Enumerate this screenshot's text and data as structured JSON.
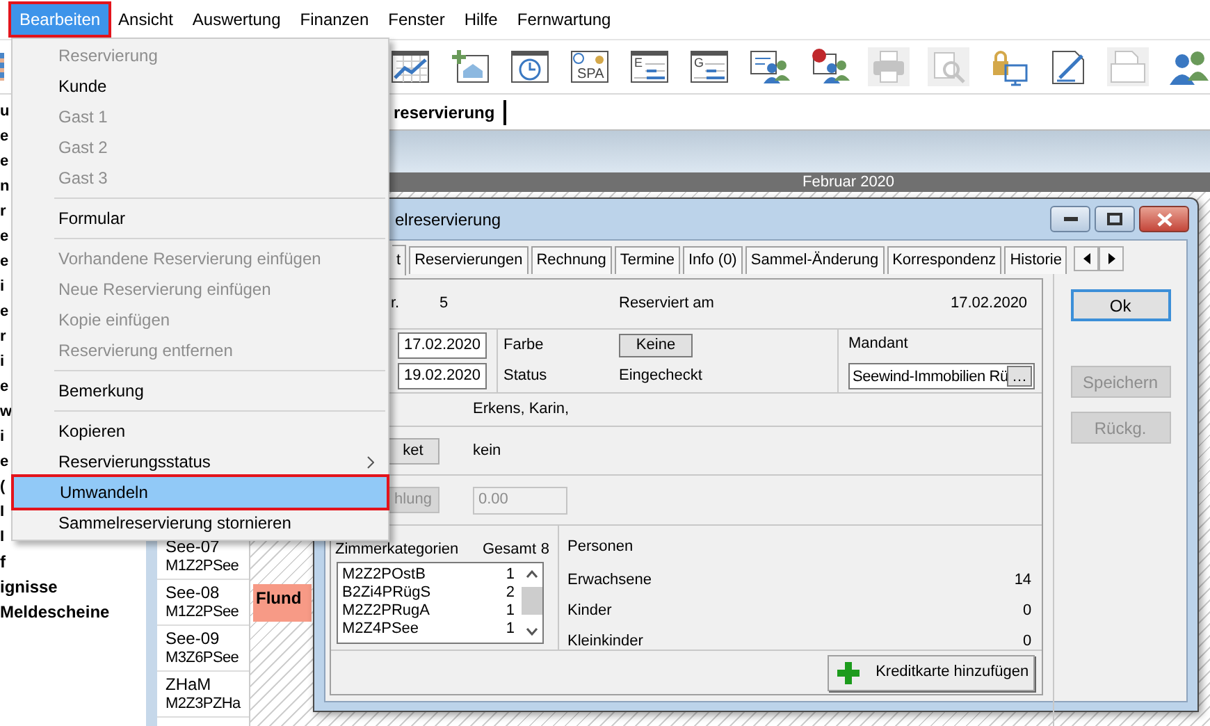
{
  "menubar": [
    {
      "label": "Bearbeiten",
      "selected": true
    },
    {
      "label": "Ansicht",
      "selected": false
    },
    {
      "label": "Auswertung",
      "selected": false
    },
    {
      "label": "Finanzen",
      "selected": false
    },
    {
      "label": "Fenster",
      "selected": false
    },
    {
      "label": "Hilfe",
      "selected": false
    },
    {
      "label": "Fernwartung",
      "selected": false
    }
  ],
  "toolbar": [
    {
      "kind": "chart",
      "disabled": false
    },
    {
      "kind": "add-house",
      "disabled": false
    },
    {
      "kind": "clock",
      "disabled": false
    },
    {
      "kind": "spa",
      "label": "SPA",
      "disabled": false
    },
    {
      "kind": "list",
      "label": "E",
      "disabled": false
    },
    {
      "kind": "list",
      "label": "G",
      "disabled": false
    },
    {
      "kind": "guests",
      "disabled": false
    },
    {
      "kind": "guests-question",
      "disabled": false
    },
    {
      "kind": "printer",
      "disabled": true
    },
    {
      "kind": "preview",
      "disabled": true
    },
    {
      "kind": "lock-screen",
      "disabled": false
    },
    {
      "kind": "edit",
      "disabled": false
    },
    {
      "kind": "letter",
      "disabled": true
    },
    {
      "kind": "users",
      "disabled": false
    }
  ],
  "document_tab": {
    "label": "reservierung"
  },
  "sidebar": {
    "fragments": [
      "u",
      "e",
      "e",
      "n",
      "r",
      "e",
      "e",
      "i",
      "e",
      "r",
      "i",
      "e",
      "w",
      "i",
      "e",
      "(",
      "I",
      "I"
    ],
    "items": [
      "f",
      "ignisse",
      "Meldescheine"
    ]
  },
  "calendar": {
    "month": "Februar 2020",
    "rooms": [
      {
        "name": "See-07",
        "category": "M1Z2PSee"
      },
      {
        "name": "See-08",
        "category": "M1Z2PSee",
        "booking": {
          "label": "Flund",
          "color": "#f79a86"
        }
      },
      {
        "name": "See-09",
        "category": "M3Z6PSee"
      },
      {
        "name": "ZHaM",
        "category": "M2Z3PZHa"
      }
    ]
  },
  "dialog": {
    "title": "elreservierung",
    "tabs": [
      {
        "label": "t",
        "selected": true
      },
      {
        "label": "Reservierungen",
        "selected": false
      },
      {
        "label": "Rechnung",
        "selected": false
      },
      {
        "label": "Termine",
        "selected": false
      },
      {
        "label": "Info (0)",
        "selected": false
      },
      {
        "label": "Sammel-Änderung",
        "selected": false
      },
      {
        "label": "Korrespondenz",
        "selected": false
      },
      {
        "label": "Historie",
        "selected": false
      }
    ],
    "number_label": "r.",
    "number": "5",
    "reserved_label": "Reserviert am",
    "reserved_date": "17.02.2020",
    "arrival": "17.02.2020",
    "departure": "19.02.2020",
    "color_label": "Farbe",
    "color_button": "Keine",
    "status_label": "Status",
    "status": "Eingecheckt",
    "client_label": "Mandant",
    "client": "Seewind-Immobilien Rü",
    "client_button": "…",
    "guest": "Erkens, Karin,",
    "ticket_button": "ket",
    "ticket": "kein",
    "payment_button": {
      "label": "hlung",
      "disabled": true
    },
    "payment": {
      "value": "0.00",
      "disabled": true
    },
    "room_categories": {
      "label": "Zimmerkategorien",
      "total_label": "Gesamt",
      "total": "8",
      "rows": [
        {
          "name": "M2Z2POstB",
          "count": "1"
        },
        {
          "name": "B2Zi4PRügS",
          "count": "2"
        },
        {
          "name": "M2Z2PRugA",
          "count": "1"
        },
        {
          "name": "M2Z4PSee",
          "count": "1"
        }
      ]
    },
    "persons": {
      "label": "Personen",
      "rows": [
        {
          "label": "Erwachsene",
          "value": "14"
        },
        {
          "label": "Kinder",
          "value": "0"
        },
        {
          "label": "Kleinkinder",
          "value": "0"
        }
      ]
    },
    "credit_card_button": "Kreditkarte hinzufügen",
    "buttons": [
      {
        "label": "Ok",
        "default": true,
        "disabled": false
      },
      {
        "label": "Speichern",
        "default": false,
        "disabled": true
      },
      {
        "label": "Rückg.",
        "default": false,
        "disabled": true
      }
    ]
  },
  "edit_menu": [
    {
      "kind": "item",
      "label": "Reservierung",
      "disabled": true,
      "selected": false,
      "submenu": false
    },
    {
      "kind": "item",
      "label": "Kunde",
      "disabled": false,
      "selected": false,
      "submenu": false
    },
    {
      "kind": "item",
      "label": "Gast 1",
      "disabled": true,
      "selected": false,
      "submenu": false
    },
    {
      "kind": "item",
      "label": "Gast 2",
      "disabled": true,
      "selected": false,
      "submenu": false
    },
    {
      "kind": "item",
      "label": "Gast 3",
      "disabled": true,
      "selected": false,
      "submenu": false
    },
    {
      "kind": "separator"
    },
    {
      "kind": "item",
      "label": "Formular",
      "disabled": false,
      "selected": false,
      "submenu": false
    },
    {
      "kind": "separator"
    },
    {
      "kind": "item",
      "label": "Vorhandene Reservierung einfügen",
      "disabled": true,
      "selected": false,
      "submenu": false
    },
    {
      "kind": "item",
      "label": "Neue Reservierung einfügen",
      "disabled": true,
      "selected": false,
      "submenu": false
    },
    {
      "kind": "item",
      "label": "Kopie einfügen",
      "disabled": true,
      "selected": false,
      "submenu": false
    },
    {
      "kind": "item",
      "label": "Reservierung entfernen",
      "disabled": true,
      "selected": false,
      "submenu": false
    },
    {
      "kind": "separator"
    },
    {
      "kind": "item",
      "label": "Bemerkung",
      "disabled": false,
      "selected": false,
      "submenu": false
    },
    {
      "kind": "separator"
    },
    {
      "kind": "item",
      "label": "Kopieren",
      "disabled": false,
      "selected": false,
      "submenu": false
    },
    {
      "kind": "item",
      "label": "Reservierungsstatus",
      "disabled": false,
      "selected": false,
      "submenu": true
    },
    {
      "kind": "item",
      "label": "Umwandeln",
      "disabled": false,
      "selected": true,
      "submenu": false
    },
    {
      "kind": "item",
      "label": "Sammelreservierung stornieren",
      "disabled": false,
      "selected": false,
      "submenu": false
    }
  ]
}
